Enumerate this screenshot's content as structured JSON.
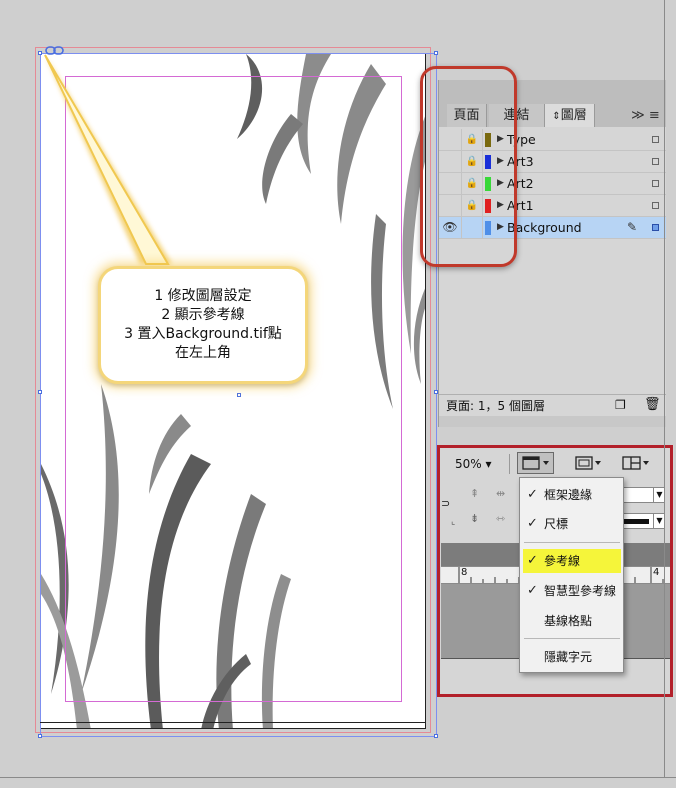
{
  "callout": {
    "lines": [
      "1 修改圖層設定",
      "2 顯示參考線",
      "3 置入Background.tif點",
      "在左上角"
    ]
  },
  "layers_panel": {
    "tabs": [
      "頁面",
      "連結",
      "圖層"
    ],
    "active_tab": "圖層",
    "menu_glyph": "≫ ≡",
    "layers": [
      {
        "name": "Type",
        "color": "#7a6a10",
        "locked": true,
        "visible": false,
        "selected": false
      },
      {
        "name": "Art3",
        "color": "#1a2fd8",
        "locked": true,
        "visible": false,
        "selected": false
      },
      {
        "name": "Art2",
        "color": "#38d838",
        "locked": true,
        "visible": false,
        "selected": false
      },
      {
        "name": "Art1",
        "color": "#e02020",
        "locked": true,
        "visible": false,
        "selected": false
      },
      {
        "name": "Background",
        "color": "#4f8fe8",
        "locked": false,
        "visible": true,
        "selected": true
      }
    ],
    "status": "頁面: 1，5 個圖層",
    "highlight_color": "#c0392b"
  },
  "toolbar": {
    "zoom": "50%",
    "ruler_left": "8",
    "ruler_right": "4"
  },
  "view_menu": {
    "items": [
      {
        "label": "框架邊緣",
        "checked": true,
        "highlighted": false
      },
      {
        "label": "尺標",
        "checked": true,
        "highlighted": false
      },
      {
        "label": "參考線",
        "checked": true,
        "highlighted": true
      },
      {
        "label": "智慧型參考線",
        "checked": true,
        "highlighted": false
      },
      {
        "label": "基線格點",
        "checked": false,
        "highlighted": false
      },
      {
        "label": "隱藏字元",
        "checked": false,
        "highlighted": false
      }
    ]
  },
  "colors": {
    "callout_border": "#f4d67a",
    "menu_highlight": "#f5f53a",
    "frame_red": "#b3202a",
    "layer_selected": "#b7d4f4"
  }
}
